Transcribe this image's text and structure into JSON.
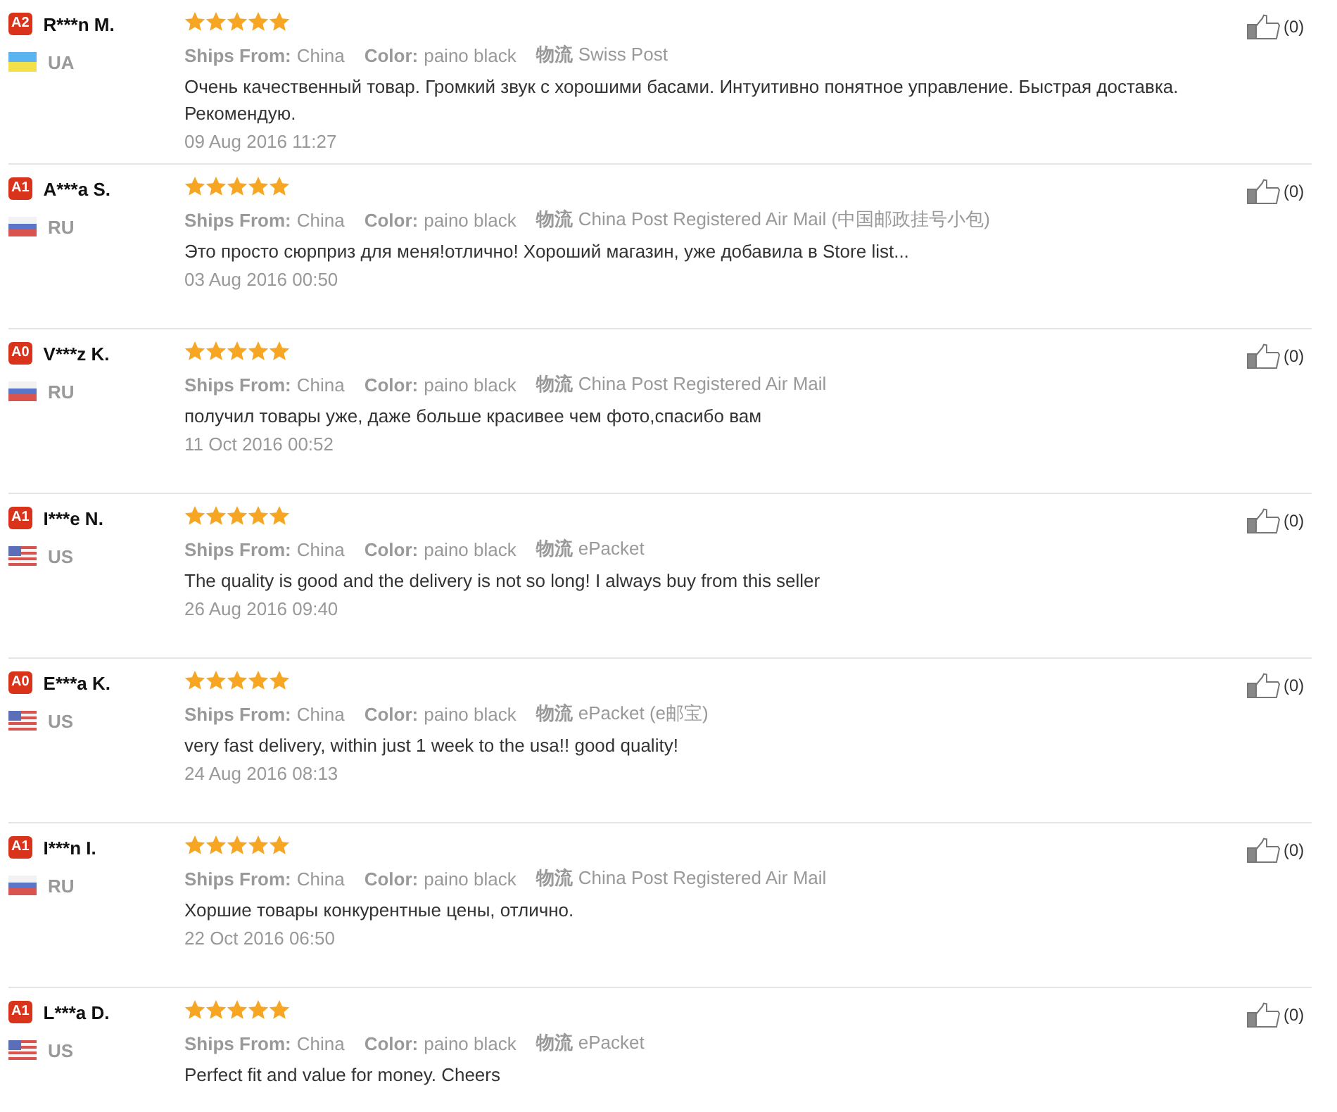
{
  "reviews": [
    {
      "level_badge": "A2",
      "name": "R***n M.",
      "kind": "ua",
      "country": "UA",
      "stars": 5,
      "ships_label": "Ships From:",
      "ships": "China",
      "color_label": "Color:",
      "color_value": "paino black",
      "logistics_label": "物流",
      "logistics": "Swiss Post",
      "text": "Очень качественный товар. Громкий звук с хорошими басами. Интуитивно понятное управление. Быстрая доставка. Рекомендую.",
      "date": "09 Aug 2016 11:27",
      "likes": "(0)"
    },
    {
      "level_badge": "A1",
      "name": "A***a S.",
      "kind": "ru",
      "country": "RU",
      "stars": 5,
      "ships_label": "Ships From:",
      "ships": "China",
      "color_label": "Color:",
      "color_value": "paino black",
      "logistics_label": "物流",
      "logistics": "China Post Registered Air Mail (中国邮政挂号小包)",
      "text": "Это просто сюрприз для меня!отлично! Хороший магазин, уже добавила в Store list...",
      "date": "03 Aug 2016 00:50",
      "likes": "(0)"
    },
    {
      "level_badge": "A0",
      "name": "V***z K.",
      "kind": "ru",
      "country": "RU",
      "stars": 5,
      "ships_label": "Ships From:",
      "ships": "China",
      "color_label": "Color:",
      "color_value": "paino black",
      "logistics_label": "物流",
      "logistics": "China Post Registered Air Mail",
      "text": "получил товары уже, даже больше красивее чем фото,спасибо вам",
      "date": "11 Oct 2016 00:52",
      "likes": "(0)"
    },
    {
      "level_badge": "A1",
      "name": "I***e N.",
      "kind": "us",
      "country": "US",
      "stars": 5,
      "ships_label": "Ships From:",
      "ships": "China",
      "color_label": "Color:",
      "color_value": "paino black",
      "logistics_label": "物流",
      "logistics": "ePacket",
      "text": "The quality is good and the delivery is not so long! I always buy from this seller",
      "date": "26 Aug 2016 09:40",
      "likes": "(0)"
    },
    {
      "level_badge": "A0",
      "name": "E***a K.",
      "kind": "us",
      "country": "US",
      "stars": 5,
      "ships_label": "Ships From:",
      "ships": "China",
      "color_label": "Color:",
      "color_value": "paino black",
      "logistics_label": "物流",
      "logistics": "ePacket (e邮宝)",
      "text": "very fast delivery, within just 1 week to the usa!! good quality!",
      "date": "24 Aug 2016 08:13",
      "likes": "(0)"
    },
    {
      "level_badge": "A1",
      "name": "I***n I.",
      "kind": "ru",
      "country": "RU",
      "stars": 5,
      "ships_label": "Ships From:",
      "ships": "China",
      "color_label": "Color:",
      "color_value": "paino black",
      "logistics_label": "物流",
      "logistics": "China Post Registered Air Mail",
      "text": "Хоршие товары конкурентные цены, отлично.",
      "date": "22 Oct 2016 06:50",
      "likes": "(0)"
    },
    {
      "level_badge": "A1",
      "name": "L***a D.",
      "kind": "us",
      "country": "US",
      "stars": 5,
      "ships_label": "Ships From:",
      "ships": "China",
      "color_label": "Color:",
      "color_value": "paino black",
      "logistics_label": "物流",
      "logistics": "ePacket",
      "text": "Perfect fit and value for money. Cheers",
      "likes": "(0)"
    }
  ]
}
